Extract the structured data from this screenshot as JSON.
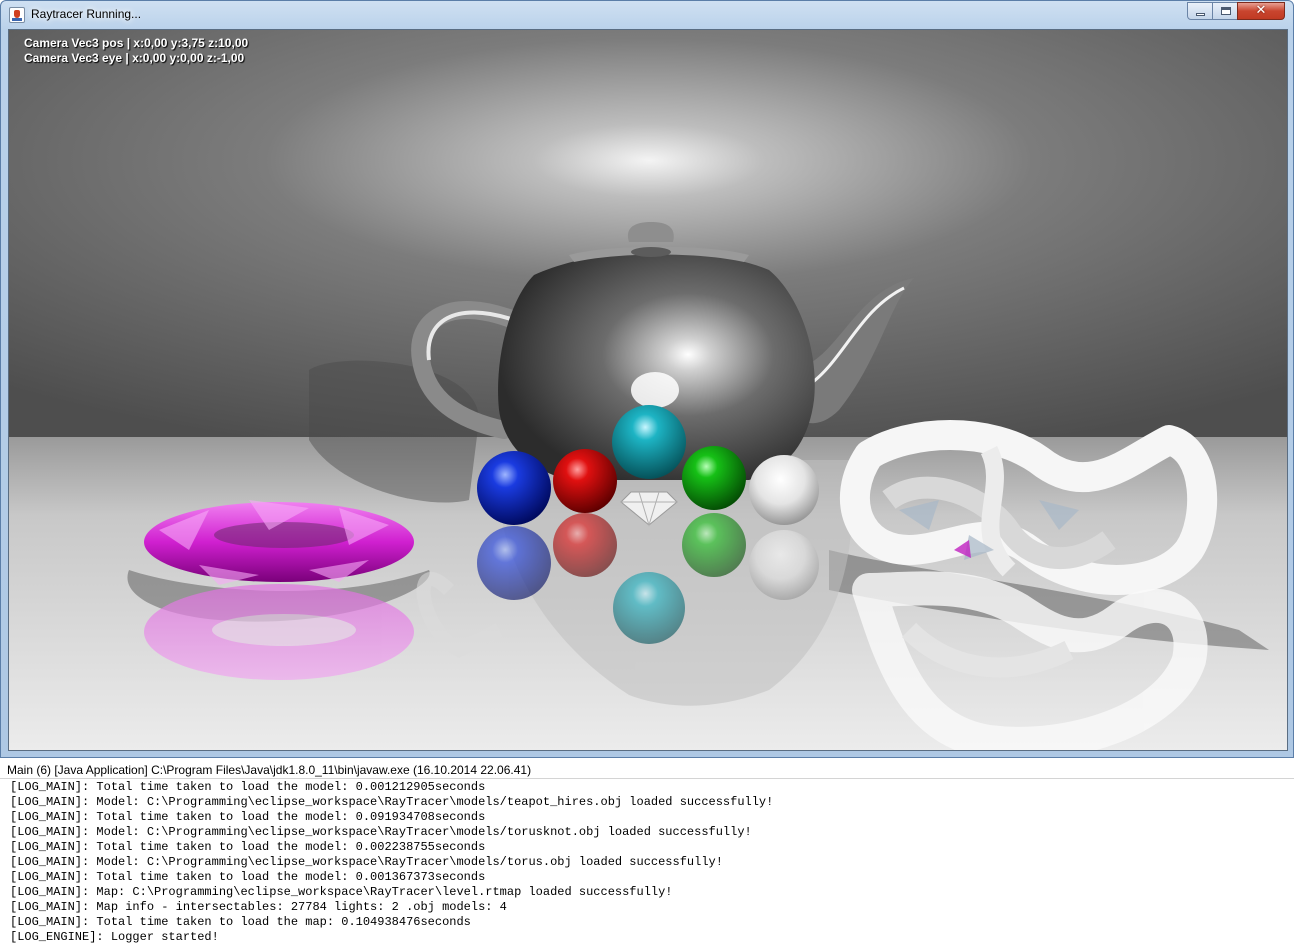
{
  "window": {
    "title": "Raytracer Running...",
    "controls": {
      "minimize": "minimize",
      "maximize": "maximize",
      "close": "✕"
    }
  },
  "viewport": {
    "camera_pos": "Camera Vec3 pos | x:0,00 y:3,75 z:10,00",
    "camera_eye": "Camera Vec3 eye | x:0,00 y:0,00 z:-1,00"
  },
  "console": {
    "title": "Main (6) [Java Application] C:\\Program Files\\Java\\jdk1.8.0_11\\bin\\javaw.exe (16.10.2014 22.06.41)",
    "lines": [
      "[LOG_MAIN]: Total time taken to load the model: 0.001212905seconds",
      "[LOG_MAIN]: Model: C:\\Programming\\eclipse_workspace\\RayTracer\\models/teapot_hires.obj loaded successfully!",
      "[LOG_MAIN]: Total time taken to load the model: 0.091934708seconds",
      "[LOG_MAIN]: Model: C:\\Programming\\eclipse_workspace\\RayTracer\\models/torusknot.obj loaded successfully!",
      "[LOG_MAIN]: Total time taken to load the model: 0.002238755seconds",
      "[LOG_MAIN]: Model: C:\\Programming\\eclipse_workspace\\RayTracer\\models/torus.obj loaded successfully!",
      "[LOG_MAIN]: Total time taken to load the model: 0.001367373seconds",
      "[LOG_MAIN]: Map: C:\\Programming\\eclipse_workspace\\RayTracer\\level.rtmap loaded successfully!",
      "[LOG_MAIN]: Map info - intersectables: 27784 lights: 2 .obj models: 4",
      "[LOG_MAIN]: Total time taken to load the map: 0.104938476seconds",
      "[LOG_ENGINE]: Logger started!"
    ]
  },
  "colors": {
    "sphere_blue": "#0010d0",
    "sphere_red": "#d00000",
    "sphere_cyan": "#10a8b8",
    "sphere_green": "#10b010",
    "torus_magenta": "#d020d0"
  }
}
